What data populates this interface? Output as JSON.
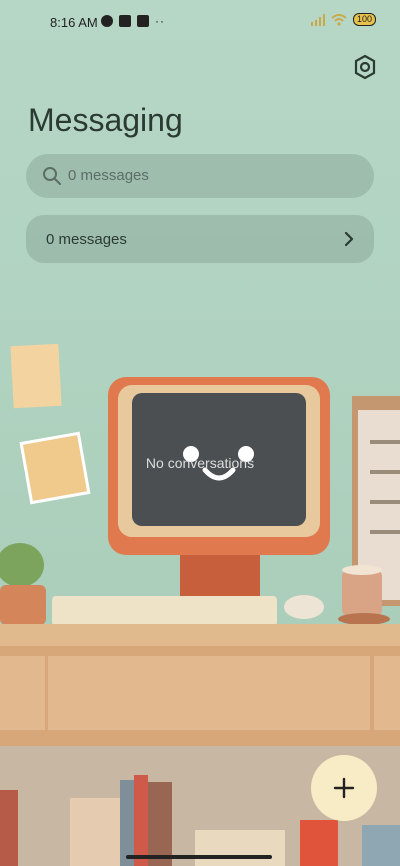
{
  "status_bar": {
    "time": "8:16 AM",
    "dots": "··",
    "battery": "100",
    "icons": [
      "chrome-icon",
      "app-icon",
      "upload-icon",
      "signal-icon",
      "wifi-icon",
      "battery-icon"
    ]
  },
  "header": {
    "title": "Messaging",
    "settings_icon": "gear-icon"
  },
  "search": {
    "placeholder": "0 messages",
    "icon": "search-icon"
  },
  "summary_row": {
    "label": "0 messages",
    "icon": "chevron-right-icon"
  },
  "empty_state": {
    "text": "No conversations"
  },
  "fab": {
    "icon": "plus-icon"
  },
  "colors": {
    "wall": "#a9cdbc",
    "title": "#2b3a33",
    "fab_bg": "#f7ecc6",
    "monitor_frame": "#e07a4e"
  }
}
